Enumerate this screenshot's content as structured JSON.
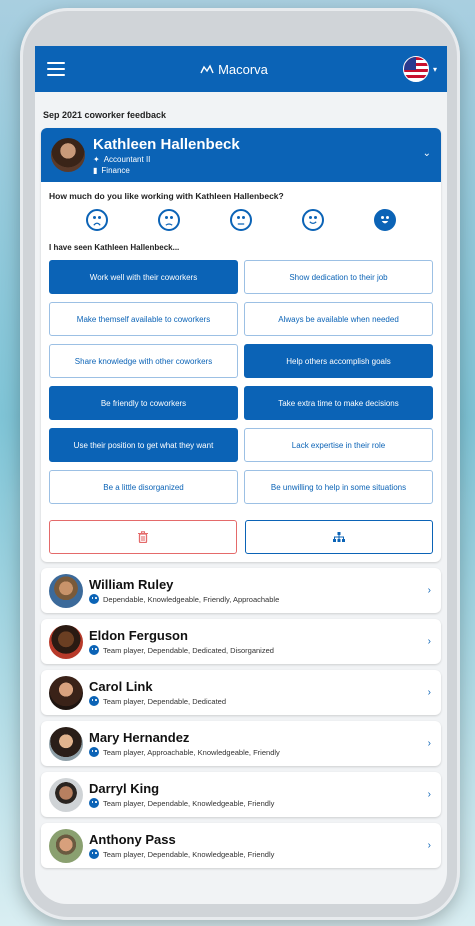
{
  "app": {
    "title": "Macorva"
  },
  "section_title": "Sep 2021 coworker feedback",
  "selected": {
    "name": "Kathleen Hallenbeck",
    "role": "Accountant II",
    "department": "Finance",
    "question": "How much do you like working with Kathleen Hallenbeck?",
    "seen_label": "I have seen Kathleen Hallenbeck...",
    "faces": [
      {
        "name": "very-unhappy-face",
        "selected": false
      },
      {
        "name": "unhappy-face",
        "selected": false
      },
      {
        "name": "neutral-face",
        "selected": false
      },
      {
        "name": "happy-face",
        "selected": false
      },
      {
        "name": "very-happy-face",
        "selected": true
      }
    ],
    "chips": [
      {
        "label": "Work well with their coworkers",
        "selected": true
      },
      {
        "label": "Show dedication to their job",
        "selected": false
      },
      {
        "label": "Make themself available to coworkers",
        "selected": false
      },
      {
        "label": "Always be available when needed",
        "selected": false
      },
      {
        "label": "Share knowledge with other coworkers",
        "selected": false
      },
      {
        "label": "Help others accomplish goals",
        "selected": true
      },
      {
        "label": "Be friendly to coworkers",
        "selected": true
      },
      {
        "label": "Take extra time to make decisions",
        "selected": true
      },
      {
        "label": "Use their position to get what they want",
        "selected": true
      },
      {
        "label": "Lack expertise in their role",
        "selected": false
      },
      {
        "label": "Be a little disorganized",
        "selected": false
      },
      {
        "label": "Be unwilling to help in some situations",
        "selected": false
      }
    ]
  },
  "people": [
    {
      "name": "William Ruley",
      "tags": "Dependable, Knowledgeable, Friendly, Approachable"
    },
    {
      "name": "Eldon Ferguson",
      "tags": "Team player, Dependable, Dedicated, Disorganized"
    },
    {
      "name": "Carol Link",
      "tags": "Team player, Dependable, Dedicated"
    },
    {
      "name": "Mary Hernandez",
      "tags": "Team player, Approachable, Knowledgeable, Friendly"
    },
    {
      "name": "Darryl King",
      "tags": "Team player, Dependable, Knowledgeable, Friendly"
    },
    {
      "name": "Anthony Pass",
      "tags": "Team player, Dependable, Knowledgeable, Friendly"
    }
  ],
  "colors": {
    "primary": "#0b63b6",
    "danger": "#e46a6a"
  }
}
